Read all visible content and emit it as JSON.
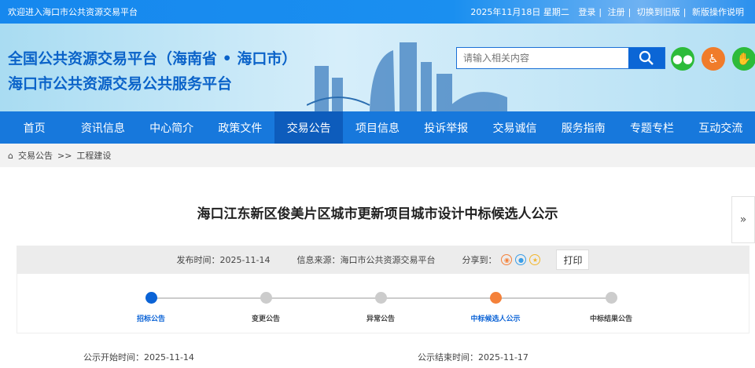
{
  "topbar": {
    "welcome": "欢迎进入海口市公共资源交易平台",
    "date": "2025年11月18日 星期二",
    "login": "登录",
    "register": "注册",
    "old": "切换到旧版",
    "guide": "新版操作说明"
  },
  "header": {
    "title1": "全国公共资源交易平台（海南省 • 海口市）",
    "title2": "海口市公共资源交易公共服务平台",
    "search_placeholder": "请输入相关内容"
  },
  "nav": [
    "首页",
    "资讯信息",
    "中心简介",
    "政策文件",
    "交易公告",
    "项目信息",
    "投诉举报",
    "交易诚信",
    "服务指南",
    "专题专栏",
    "互动交流"
  ],
  "breadcrumb": {
    "a": "交易公告",
    "sep": ">>",
    "b": "工程建设"
  },
  "article": {
    "title": "海口江东新区俊美片区城市更新项目城市设计中标候选人公示",
    "publish": "发布时间：2025-11-14",
    "source": "信息来源：海口市公共资源交易平台",
    "share": "分享到：",
    "print": "打印",
    "start": "公示开始时间：2025-11-14",
    "end": "公示结束时间：2025-11-17"
  },
  "steps": [
    {
      "label": "招标公告",
      "state": "done"
    },
    {
      "label": "变更公告",
      "state": "none"
    },
    {
      "label": "异常公告",
      "state": "none"
    },
    {
      "label": "中标候选人公示",
      "state": "current"
    },
    {
      "label": "中标结果公告",
      "state": "none"
    }
  ],
  "colors": {
    "blue": "#0b63d6",
    "orange": "#f4813a",
    "grey": "#cccccc"
  }
}
